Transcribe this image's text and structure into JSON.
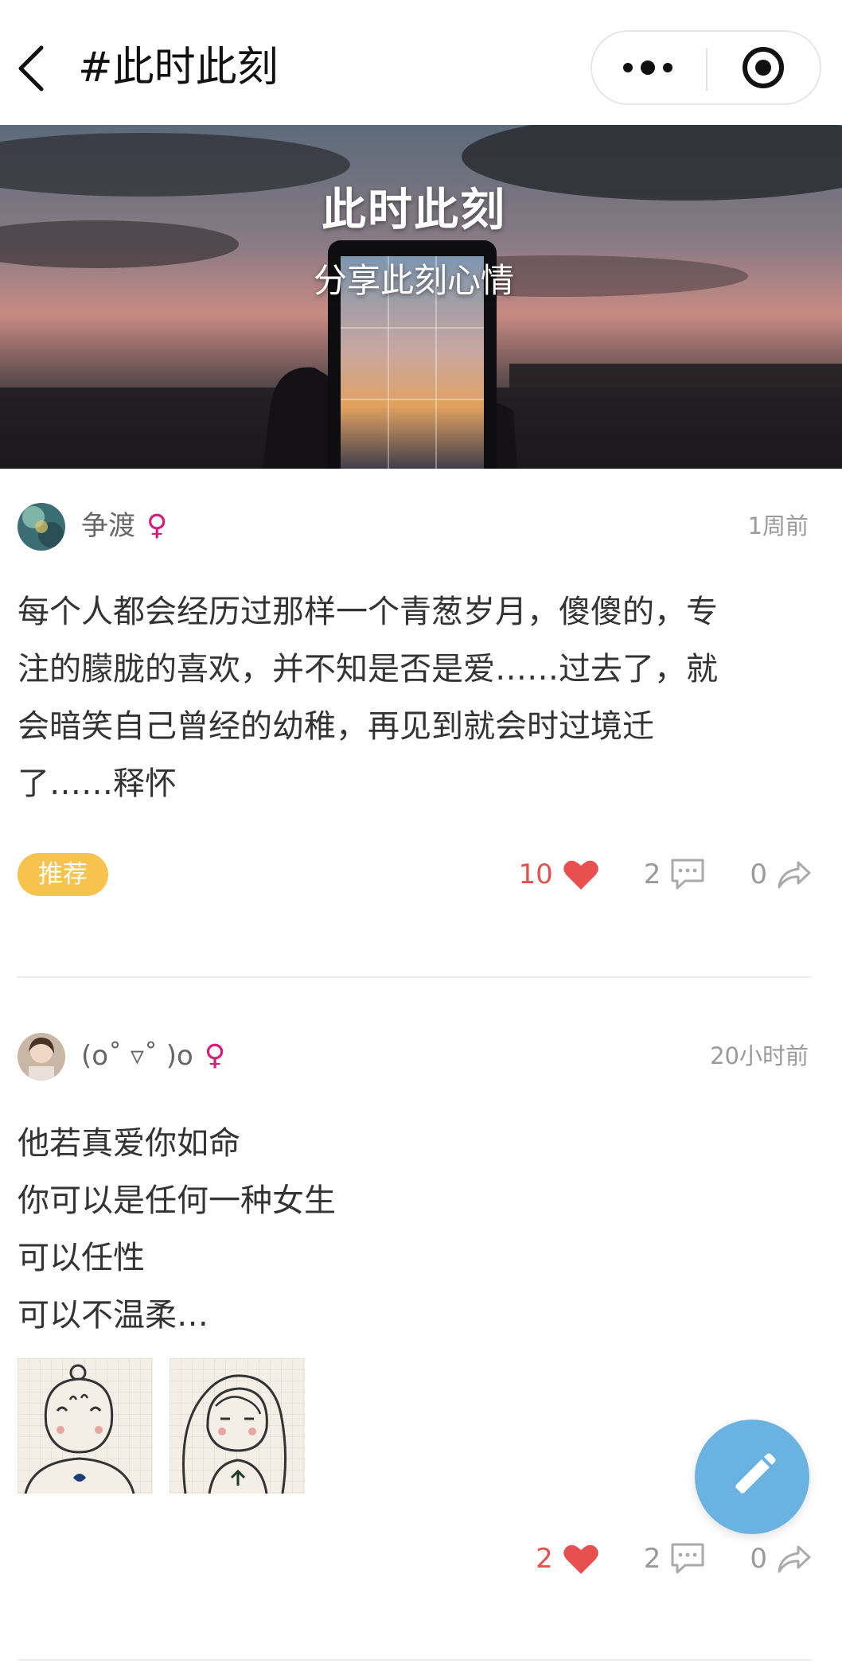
{
  "header": {
    "title": "#此时此刻"
  },
  "banner": {
    "title": "此时此刻",
    "subtitle": "分享此刻心情"
  },
  "posts": [
    {
      "author": "争渡",
      "gender": "♀",
      "time": "1周前",
      "content": "每个人都会经历过那样一个青葱岁月，傻傻的，专\n注的朦胧的喜欢，并不知是否是爱……过去了，就\n会暗笑自己曾经的幼稚，再见到就会时过境迁\n了……释怀",
      "tag": "推荐",
      "likes": "10",
      "comments": "2",
      "shares": "0"
    },
    {
      "author": "(o˚ ▿˚ )o",
      "gender": "♀",
      "time": "20小时前",
      "content": "他若真爱你如命\n你可以是任何一种女生\n可以任性\n可以不温柔…",
      "likes": "2",
      "comments": "2",
      "shares": "0"
    }
  ],
  "icons": {
    "back": "chevron-left-icon",
    "more": "more-dots-icon",
    "target": "target-icon",
    "like": "heart-icon",
    "comment": "comment-icon",
    "share": "share-icon",
    "compose": "pencil-icon"
  },
  "colors": {
    "accent_like": "#e8504f",
    "gender": "#d81b79",
    "tag_bg": "#f7c34e",
    "fab_bg": "#6ab2e2"
  }
}
